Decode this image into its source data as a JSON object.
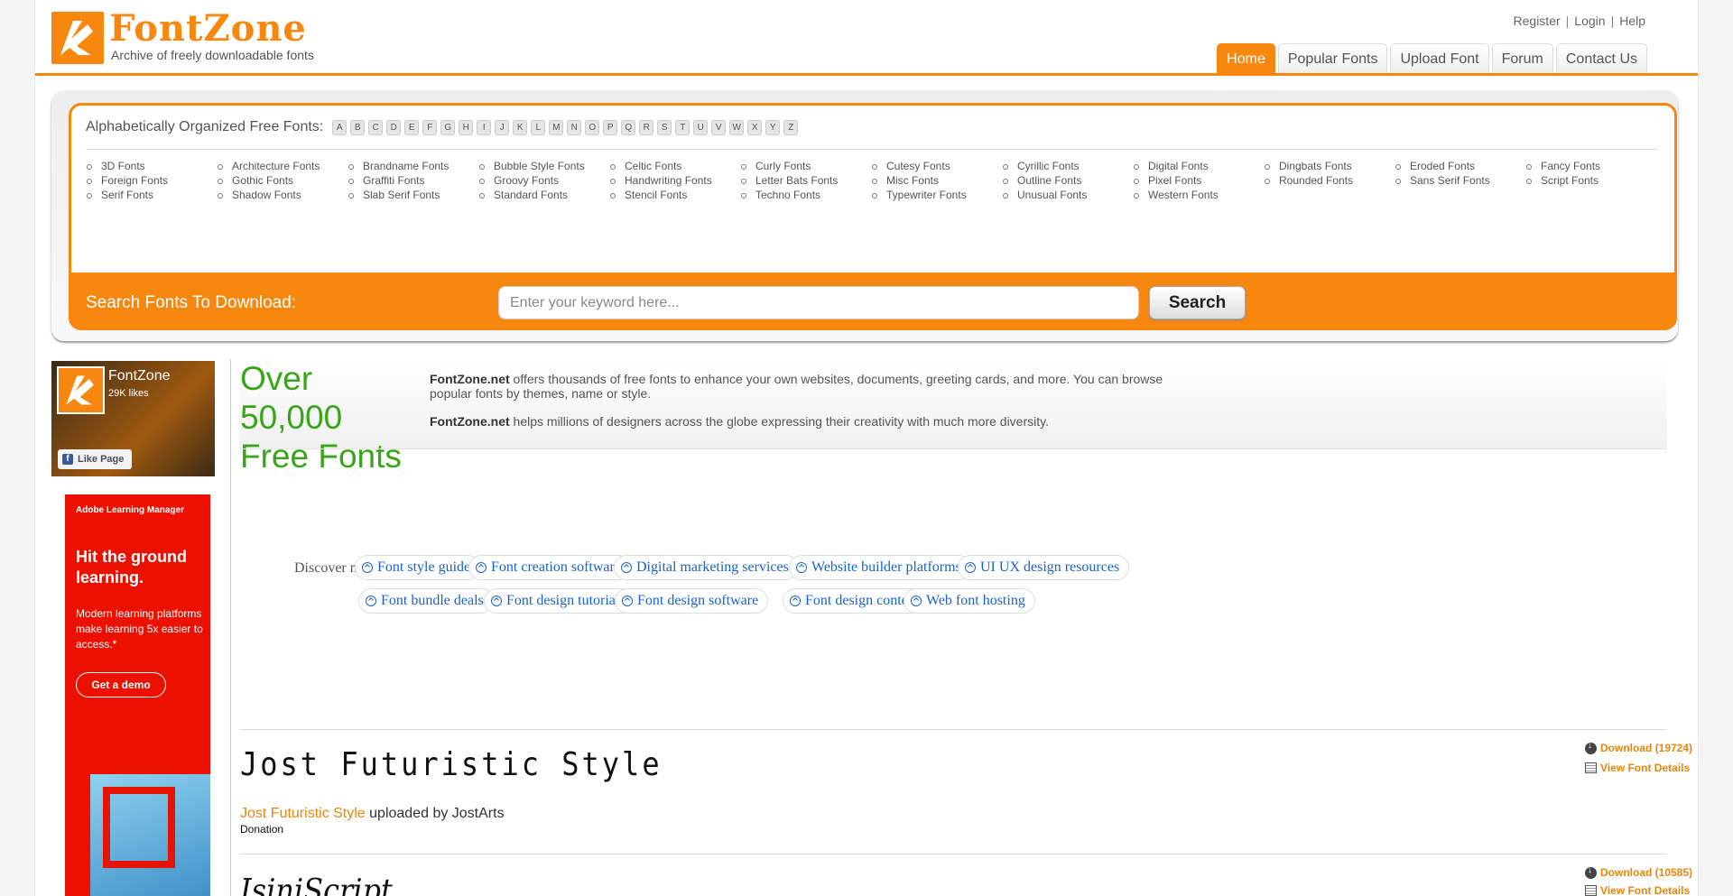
{
  "site": {
    "name": "FontZone",
    "tagline": "Archive of freely downloadable fonts"
  },
  "top_links": [
    "Register",
    "Login",
    "Help"
  ],
  "nav": [
    {
      "label": "Home",
      "active": true
    },
    {
      "label": "Popular Fonts",
      "active": false
    },
    {
      "label": "Upload Font",
      "active": false
    },
    {
      "label": "Forum",
      "active": false
    },
    {
      "label": "Contact Us",
      "active": false
    }
  ],
  "alphabet": {
    "label": "Alphabetically Organized Free Fonts:",
    "letters": [
      "A",
      "B",
      "C",
      "D",
      "E",
      "F",
      "G",
      "H",
      "I",
      "J",
      "K",
      "L",
      "M",
      "N",
      "O",
      "P",
      "Q",
      "R",
      "S",
      "T",
      "U",
      "V",
      "W",
      "X",
      "Y",
      "Z"
    ]
  },
  "categories": [
    [
      "3D Fonts",
      "Foreign Fonts",
      "Serif Fonts"
    ],
    [
      "Architecture Fonts",
      "Gothic Fonts",
      "Shadow Fonts"
    ],
    [
      "Brandname Fonts",
      "Graffiti Fonts",
      "Slab Serif Fonts"
    ],
    [
      "Bubble Style Fonts",
      "Groovy Fonts",
      "Standard Fonts"
    ],
    [
      "Celtic Fonts",
      "Handwriting Fonts",
      "Stencil Fonts"
    ],
    [
      "Curly Fonts",
      "Letter Bats Fonts",
      "Techno Fonts"
    ],
    [
      "Cutesy Fonts",
      "Misc Fonts",
      "Typewriter Fonts"
    ],
    [
      "Cyrillic Fonts",
      "Outline Fonts",
      "Unusual Fonts"
    ],
    [
      "Digital Fonts",
      "Pixel Fonts",
      "Western Fonts"
    ],
    [
      "Dingbats Fonts",
      "Rounded Fonts"
    ],
    [
      "Eroded Fonts",
      "Sans Serif Fonts"
    ],
    [
      "Fancy Fonts",
      "Script Fonts"
    ]
  ],
  "search": {
    "label": "Search Fonts To Download:",
    "placeholder": "Enter your keyword here...",
    "button": "Search"
  },
  "facebook": {
    "name": "FontZone",
    "likes": "29K likes",
    "like_button": "Like Page"
  },
  "ad": {
    "brand": "Adobe Learning Manager",
    "headline": "Hit the ground learning.",
    "body": "Modern learning platforms make learning 5x easier to access.*",
    "cta": "Get a demo"
  },
  "hero": {
    "title_line1": "Over 50,000",
    "title_line2": "Free Fonts",
    "p1_brand": "FontZone.net",
    "p1_text": " offers thousands of free fonts to enhance your own websites, documents, greeting cards, and more. You can browse popular fonts by themes, name or style.",
    "p2_brand": "FontZone.net",
    "p2_text": " helps millions of designers across the globe expressing their creativity with much more diversity."
  },
  "discover": {
    "label": "Discover more",
    "row1": [
      "Font style guide",
      "Font creation software",
      "Digital marketing services",
      "Website builder platforms",
      "UI UX design resources"
    ],
    "row2": [
      "Font bundle deals",
      "Font design tutorials",
      "Font design software",
      "Font design contest",
      "Web font hosting"
    ]
  },
  "fonts": [
    {
      "preview": "Jost Futuristic Style",
      "name": "Jost Futuristic Style",
      "uploader_text": " uploaded by JostArts",
      "license": "Donation",
      "download": "Download (19724)",
      "details": "View Font Details"
    },
    {
      "preview": "IsiniScript",
      "download": "Download (10585)",
      "details": "View Font Details"
    }
  ]
}
